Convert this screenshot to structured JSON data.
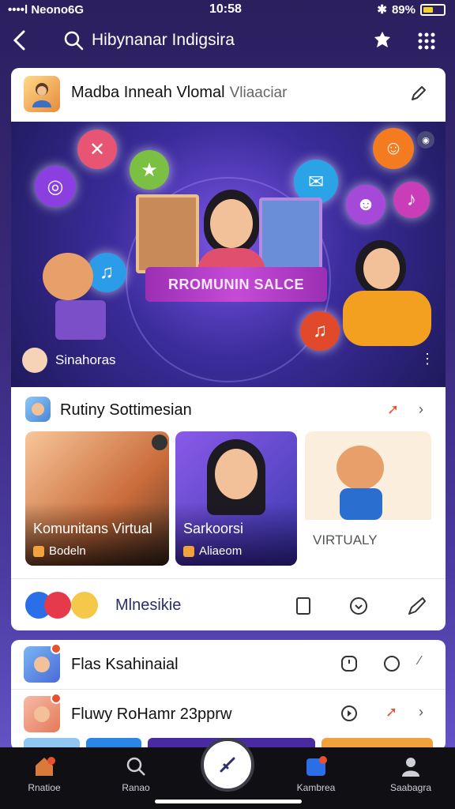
{
  "status": {
    "carrier": "••••l Neono6G",
    "time": "10:58",
    "battery": "89%"
  },
  "topbar": {
    "title": "Hibynanar Indigsira"
  },
  "post": {
    "author": "Madba Inneah Vlomal",
    "author_sub": "Vliaaciar",
    "banner_text": "RROMUNIN SALCE",
    "hero_caption": "Sinahoras"
  },
  "section": {
    "title": "Rutiny Sottimesian",
    "tiles": [
      {
        "title": "Komunitans Virtual",
        "sub": "Bodeln"
      },
      {
        "title": "Sarkoorsi",
        "sub": "Aliaeom"
      },
      {
        "title": "VIRTUALY",
        "sub": ""
      }
    ]
  },
  "actions": {
    "label": "Mlnesikie"
  },
  "feed": [
    {
      "title": "Flas Ksahinaial"
    },
    {
      "title": "Fluwy RoHamr 23pprw"
    }
  ],
  "nav": [
    {
      "label": "Rnatioe",
      "icon": "home-icon"
    },
    {
      "label": "Ranao",
      "icon": "search-icon"
    },
    {
      "label": "",
      "icon": "create-icon"
    },
    {
      "label": "Kambrea",
      "icon": "activity-icon"
    },
    {
      "label": "Saabagra",
      "icon": "profile-icon"
    }
  ]
}
